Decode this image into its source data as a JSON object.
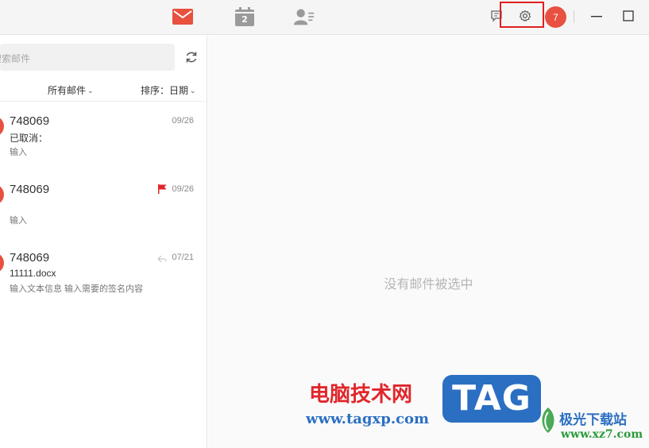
{
  "toolbar": {
    "nav_icons": [
      "mail-icon",
      "calendar-icon",
      "contacts-icon"
    ],
    "calendar_day": "2",
    "avatar_badge": "7",
    "accent": "#e8503f",
    "highlight_color": "#e02020"
  },
  "sidebar": {
    "search_placeholder": "搜索邮件",
    "filter_label": "所有邮件",
    "sort_label": "排序：日期"
  },
  "mails": [
    {
      "sender": "748069",
      "date": "09/26",
      "subject": "已取消：",
      "preview": "输入",
      "flagged": false,
      "replied": false
    },
    {
      "sender": "748069",
      "date": "09/26",
      "subject": "",
      "preview": "输入",
      "flagged": true,
      "replied": false
    },
    {
      "sender": "748069",
      "date": "07/21",
      "subject": "11111.docx",
      "preview": "输入文本信息 输入需要的签名内容",
      "flagged": false,
      "replied": true
    }
  ],
  "reading_pane": {
    "empty_message": "没有邮件被选中"
  },
  "watermark": {
    "title": "电脑技术网",
    "tag": "TAG",
    "url": "www.tagxp.com",
    "site_name": "极光下载站",
    "site_url": "www.xz7.com"
  }
}
